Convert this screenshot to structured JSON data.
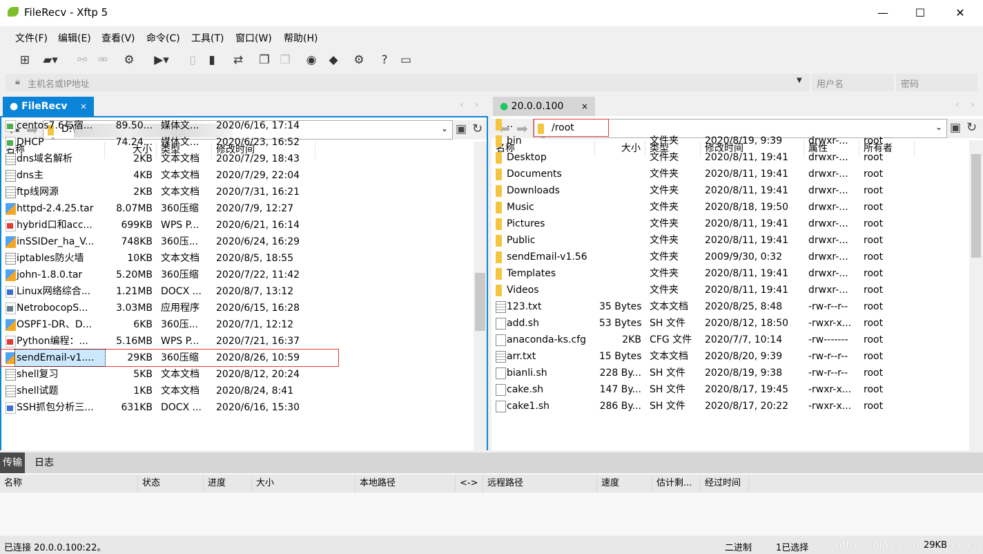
{
  "window": {
    "title": "FileRecv - Xftp 5",
    "minimize": "—",
    "maximize": "☐",
    "close": "✕"
  },
  "menu": [
    "文件(F)",
    "编辑(E)",
    "查看(V)",
    "命令(C)",
    "工具(T)",
    "窗口(W)",
    "帮助(H)"
  ],
  "toolbar": [
    {
      "icon": "new-session-icon",
      "g": "⊞"
    },
    {
      "icon": "open-folder-icon",
      "g": "▰▾"
    },
    {
      "icon": "connect-icon",
      "g": "⚯",
      "disabled": true
    },
    {
      "icon": "disconnect-icon",
      "g": "⚮",
      "disabled": true
    },
    {
      "icon": "session-settings-icon",
      "g": "⚙"
    },
    {
      "icon": "play-icon",
      "g": "▶▾"
    },
    {
      "icon": "upload-icon",
      "g": "▯",
      "disabled": true
    },
    {
      "icon": "download-icon",
      "g": "▮"
    },
    {
      "icon": "sync-icon",
      "g": "⇄"
    },
    {
      "icon": "copy-icon",
      "g": "❐"
    },
    {
      "icon": "paste-icon",
      "g": "❐",
      "disabled": true
    },
    {
      "icon": "xshell-icon",
      "g": "◉"
    },
    {
      "icon": "xftp-icon",
      "g": "◆"
    },
    {
      "icon": "gear-icon",
      "g": "⚙"
    },
    {
      "icon": "help-icon",
      "g": "?"
    },
    {
      "icon": "feedback-icon",
      "g": "▭"
    }
  ],
  "address": {
    "host_placeholder": "主机名或IP地址",
    "username_placeholder": "用户名",
    "password_placeholder": "密码"
  },
  "left": {
    "tab": "FileRecv",
    "tab_close": "×",
    "path": "D:\\",
    "columns": [
      "名称",
      "大小",
      "类型",
      "修改时间"
    ],
    "rows": [
      [
        "centos7.6与宿...",
        "89.50...",
        "媒体文...",
        "2020/6/16, 17:14",
        "media"
      ],
      [
        "DHCP",
        "74.24...",
        "媒体文...",
        "2020/6/23, 16:52",
        "media"
      ],
      [
        "dns域名解析",
        "2KB",
        "文本文档",
        "2020/7/29, 18:43",
        "txt"
      ],
      [
        "dns主",
        "4KB",
        "文本文档",
        "2020/7/29, 22:04",
        "txt"
      ],
      [
        "ftp线网源",
        "2KB",
        "文本文档",
        "2020/7/31, 16:21",
        "txt"
      ],
      [
        "httpd-2.4.25.tar",
        "8.07MB",
        "360压缩",
        "2020/7/9, 12:27",
        "zip"
      ],
      [
        "hybrid口和acc...",
        "699KB",
        "WPS P...",
        "2020/6/21, 16:14",
        "pdf"
      ],
      [
        "inSSIDer_ha_V...",
        "748KB",
        "360压...",
        "2020/6/24, 16:29",
        "zip"
      ],
      [
        "iptables防火墙",
        "10KB",
        "文本文档",
        "2020/8/5, 18:55",
        "txt"
      ],
      [
        "john-1.8.0.tar",
        "5.20MB",
        "360压缩",
        "2020/7/22, 11:42",
        "zip"
      ],
      [
        "Linux网络综合...",
        "1.21MB",
        "DOCX ...",
        "2020/8/7, 13:12",
        "doc"
      ],
      [
        "NetrobocopS...",
        "3.03MB",
        "应用程序",
        "2020/6/15, 16:28",
        "exe"
      ],
      [
        "OSPF1-DR、D...",
        "6KB",
        "360压...",
        "2020/7/1, 12:12",
        "zip"
      ],
      [
        "Python编程：...",
        "5.16MB",
        "WPS P...",
        "2020/7/21, 16:37",
        "pdf"
      ],
      [
        "sendEmail-v1....",
        "29KB",
        "360压缩",
        "2020/8/26, 10:59",
        "zip"
      ],
      [
        "shell复习",
        "5KB",
        "文本文档",
        "2020/8/12, 20:24",
        "txt"
      ],
      [
        "shell试题",
        "1KB",
        "文本文档",
        "2020/8/24, 8:41",
        "txt"
      ],
      [
        "SSH抓包分析三...",
        "631KB",
        "DOCX ...",
        "2020/6/16, 15:30",
        "doc"
      ]
    ],
    "selected_index": 14
  },
  "right": {
    "tab": "20.0.0.100",
    "tab_close": "×",
    "path": "/root",
    "columns": [
      "名称",
      "大小",
      "类型",
      "修改时间",
      "属性",
      "所有者"
    ],
    "rows": [
      [
        "..",
        "",
        "",
        "",
        "",
        "",
        "folder"
      ],
      [
        "bin",
        "",
        "文件夹",
        "2020/8/19, 9:39",
        "drwxr-...",
        "root",
        "folder"
      ],
      [
        "Desktop",
        "",
        "文件夹",
        "2020/8/11, 19:41",
        "drwxr-...",
        "root",
        "folder"
      ],
      [
        "Documents",
        "",
        "文件夹",
        "2020/8/11, 19:41",
        "drwxr-...",
        "root",
        "folder"
      ],
      [
        "Downloads",
        "",
        "文件夹",
        "2020/8/11, 19:41",
        "drwxr-...",
        "root",
        "folder"
      ],
      [
        "Music",
        "",
        "文件夹",
        "2020/8/18, 19:50",
        "drwxr-...",
        "root",
        "folder"
      ],
      [
        "Pictures",
        "",
        "文件夹",
        "2020/8/11, 19:41",
        "drwxr-...",
        "root",
        "folder"
      ],
      [
        "Public",
        "",
        "文件夹",
        "2020/8/11, 19:41",
        "drwxr-...",
        "root",
        "folder"
      ],
      [
        "sendEmail-v1.56",
        "",
        "文件夹",
        "2009/9/30, 0:32",
        "drwxr-...",
        "root",
        "folder"
      ],
      [
        "Templates",
        "",
        "文件夹",
        "2020/8/11, 19:41",
        "drwxr-...",
        "root",
        "folder"
      ],
      [
        "Videos",
        "",
        "文件夹",
        "2020/8/11, 19:41",
        "drwxr-...",
        "root",
        "folder"
      ],
      [
        "123.txt",
        "35 Bytes",
        "文本文档",
        "2020/8/25, 8:48",
        "-rw-r--r--",
        "root",
        "txt"
      ],
      [
        "add.sh",
        "53 Bytes",
        "SH 文件",
        "2020/8/12, 18:50",
        "-rwxr-x...",
        "root",
        "file"
      ],
      [
        "anaconda-ks.cfg",
        "2KB",
        "CFG 文件",
        "2020/7/7, 10:14",
        "-rw-------",
        "root",
        "file"
      ],
      [
        "arr.txt",
        "15 Bytes",
        "文本文档",
        "2020/8/20, 9:39",
        "-rw-r--r--",
        "root",
        "txt"
      ],
      [
        "bianli.sh",
        "228 By...",
        "SH 文件",
        "2020/8/19, 9:38",
        "-rw-r--r--",
        "root",
        "file"
      ],
      [
        "cake.sh",
        "147 By...",
        "SH 文件",
        "2020/8/17, 19:45",
        "-rwxr-x...",
        "root",
        "file"
      ],
      [
        "cake1.sh",
        "286 By...",
        "SH 文件",
        "2020/8/17, 20:22",
        "-rwxr-x...",
        "root",
        "file"
      ]
    ]
  },
  "transfer": {
    "tabs": [
      "传输",
      "日志"
    ],
    "columns": [
      "名称",
      "状态",
      "进度",
      "大小",
      "本地路径",
      "<->",
      "远程路径",
      "速度",
      "估计剩...",
      "经过时间"
    ]
  },
  "status": {
    "connection": "已连接 20.0.0.100:22。",
    "mode": "二进制",
    "selection": "1已选择",
    "size": "29KB",
    "watermark": "https://blog.csdn.net/cenjeal"
  },
  "colors": {
    "accent": "#0a84d6",
    "connected": "#22c55e",
    "highlight": "#e53935"
  }
}
